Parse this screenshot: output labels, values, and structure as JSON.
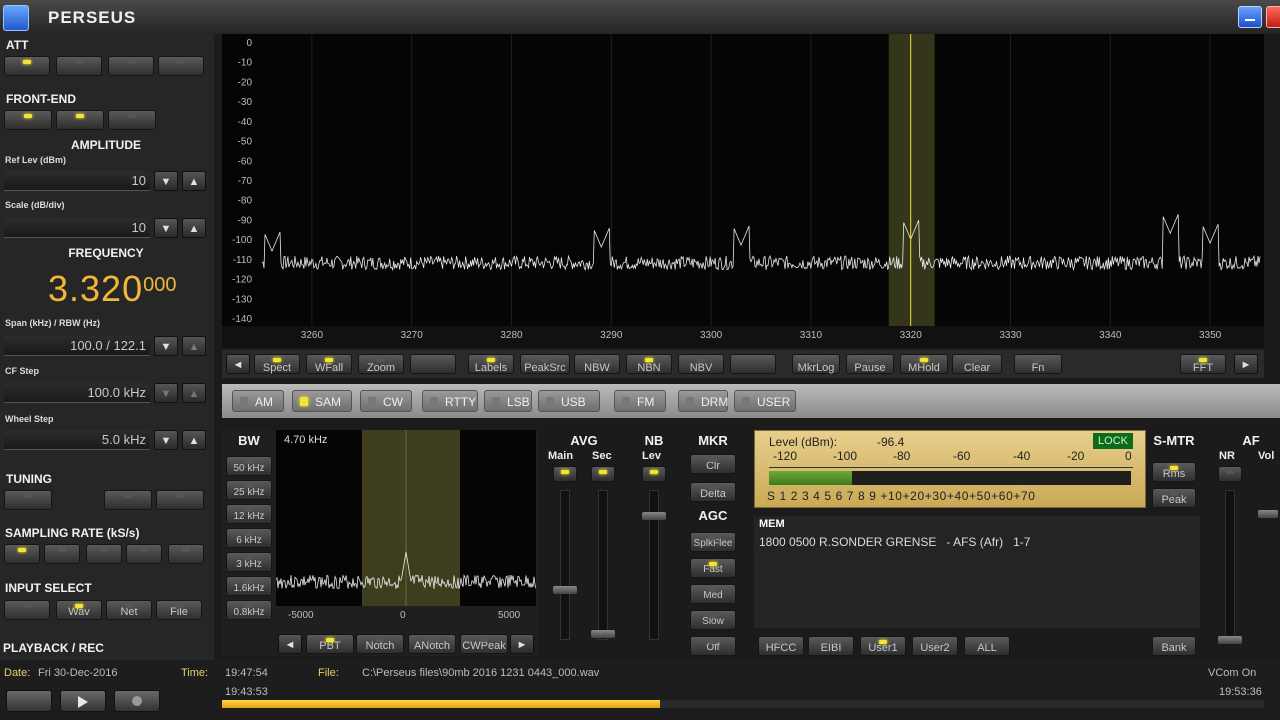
{
  "window": {
    "title": "PERSEUS"
  },
  "left": {
    "att_label": "ATT",
    "frontend_label": "FRONT-END",
    "amplitude_label": "AMPLITUDE",
    "ref_lev_label": "Ref Lev (dBm)",
    "ref_lev_value": "10",
    "scale_label": "Scale (dB/div)",
    "scale_value": "10",
    "frequency_label": "FREQUENCY",
    "freq_main": "3.320",
    "freq_sub": "000",
    "span_label": "Span (kHz) / RBW (Hz)",
    "span_value": "100.0 / 122.1",
    "cf_step_label": "CF Step",
    "cf_step_value": "100.0 kHz",
    "wheel_step_label": "Wheel Step",
    "wheel_step_value": "5.0 kHz",
    "tuning_label": "TUNING",
    "sampling_label": "SAMPLING RATE (kS/s)",
    "input_label": "INPUT SELECT",
    "input_buttons": [
      "Wav",
      "Net",
      "File"
    ],
    "playback_label": "PLAYBACK / REC"
  },
  "spectrum": {
    "y_ticks": [
      "0",
      "-10",
      "-20",
      "-30",
      "-40",
      "-50",
      "-60",
      "-70",
      "-80",
      "-90",
      "-100",
      "-110",
      "-120",
      "-130",
      "-140"
    ],
    "x_ticks": [
      "3260",
      "3270",
      "3280",
      "3290",
      "3300",
      "3310",
      "3320",
      "3330",
      "3340",
      "3350"
    ],
    "x_min": 3255,
    "x_max": 3355,
    "y_min": -140,
    "y_max": 0,
    "marker_freq": 3320,
    "noise_floor": -112,
    "peaks": [
      {
        "f": 3256,
        "db": -106
      },
      {
        "f": 3289,
        "db": -104
      },
      {
        "f": 3303,
        "db": -103
      },
      {
        "f": 3320,
        "db": -100
      },
      {
        "f": 3346,
        "db": -97
      },
      {
        "f": 3350,
        "db": -102
      }
    ]
  },
  "toolbar": {
    "buttons": [
      "Spect",
      "WFall",
      "Zoom",
      "Labels",
      "PeakSrc",
      "NBW",
      "NBN",
      "NBV",
      "MkrLog",
      "Pause",
      "MHold",
      "Clear",
      "Fn",
      "FFT"
    ],
    "led_on": [
      0,
      1,
      3,
      6,
      10,
      13
    ],
    "nav_left": "◄",
    "nav_right": "►"
  },
  "modes": {
    "items": [
      "AM",
      "SAM",
      "CW",
      "RTTY",
      "LSB",
      "USB",
      "FM",
      "DRM",
      "USER"
    ],
    "active_index": 1
  },
  "bw": {
    "label": "BW",
    "value_text": "4.70 kHz",
    "presets": [
      "50 kHz",
      "25 kHz",
      "12 kHz",
      "6 kHz",
      "3 kHz",
      "1.6kHz",
      "0.8kHz"
    ],
    "x_ticks": [
      "-5000",
      "0",
      "5000"
    ],
    "bottom_buttons": [
      "PBT",
      "Notch",
      "ANotch",
      "CWPeak"
    ]
  },
  "avg": {
    "label": "AVG",
    "main": "Main",
    "sec": "Sec"
  },
  "nb": {
    "label": "NB",
    "lev": "Lev"
  },
  "mkr": {
    "label": "MKR",
    "buttons": [
      "Clr",
      "Delta"
    ]
  },
  "agc": {
    "label": "AGC",
    "buttons": [
      "SplkFlee",
      "Fast",
      "Med",
      "Slow",
      "Off"
    ]
  },
  "smeter": {
    "level_label": "Level (dBm):",
    "level_value": "-96.4",
    "lock": "LOCK",
    "top_scale": [
      "-120",
      "-100",
      "-80",
      "-60",
      "-40",
      "-20",
      "0"
    ],
    "bottom_scale": "S 1 2 3 4 5 6 7 8 9 +10+20+30+40+50+60+70",
    "fill_fraction": 0.23,
    "title": "S-MTR",
    "buttons": [
      "Rms",
      "Peak"
    ]
  },
  "af": {
    "label": "AF",
    "nr": "NR",
    "vol": "Vol"
  },
  "mem": {
    "label": "MEM",
    "entry": "1800 0500 R.SONDER GRENSE   - AFS (Afr)   1-7",
    "buttons": [
      "HFCC",
      "EIBI",
      "User1",
      "User2",
      "ALL"
    ],
    "bank": "Bank"
  },
  "status": {
    "date_label": "Date:",
    "date_value": "Fri 30-Dec-2016",
    "time_label": "Time:",
    "time_value": "19:47:54",
    "time_start": "19:43:53",
    "file_label": "File:",
    "file_value": "C:\\Perseus files\\90mb 2016 1231 0443_000.wav",
    "vcom": "VCom On",
    "time_end": "19:53:36",
    "progress": 0.42
  },
  "colors": {
    "accent": "#f2b63a",
    "led": "#f4e23a",
    "trace": "#e8e8e8",
    "marker": "#f3e83a"
  }
}
